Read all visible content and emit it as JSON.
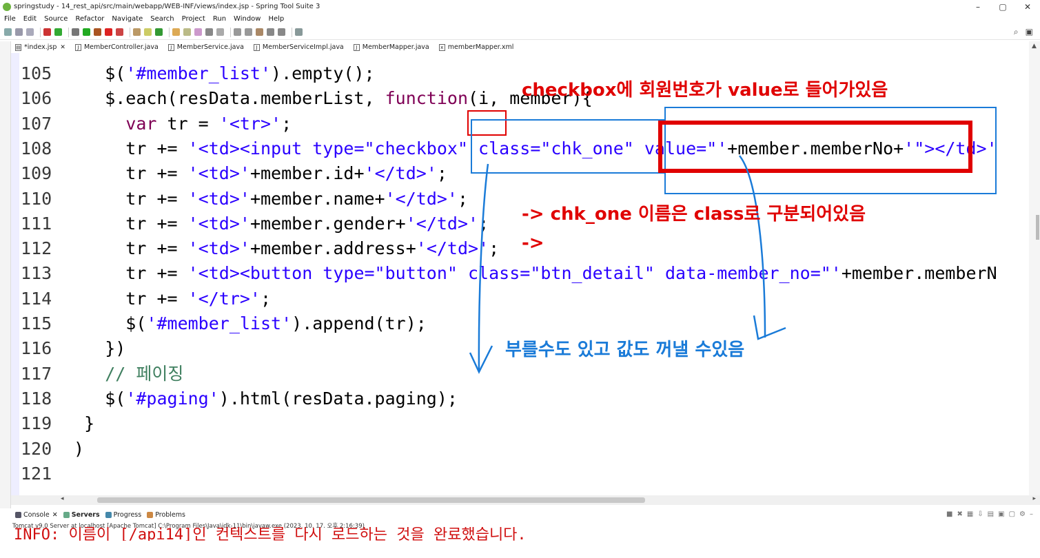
{
  "window": {
    "title": "springstudy - 14_rest_api/src/main/webapp/WEB-INF/views/index.jsp - Spring Tool Suite 3",
    "controls": [
      "–",
      "▢",
      "✕"
    ]
  },
  "menu": [
    "File",
    "Edit",
    "Source",
    "Refactor",
    "Navigate",
    "Search",
    "Project",
    "Run",
    "Window",
    "Help"
  ],
  "tabs": [
    {
      "label": "*index.jsp",
      "active": true,
      "closable": true
    },
    {
      "label": "MemberController.java"
    },
    {
      "label": "MemberService.java"
    },
    {
      "label": "MemberServiceImpl.java"
    },
    {
      "label": "MemberMapper.java"
    },
    {
      "label": "memberMapper.xml"
    }
  ],
  "code": [
    {
      "num": "105",
      "segs": [
        {
          "t": "    $(",
          "c": ""
        },
        {
          "t": "'#member_list'",
          "c": "str"
        },
        {
          "t": ").empty();",
          "c": ""
        }
      ]
    },
    {
      "num": "106",
      "segs": [
        {
          "t": "    $.each(resData.memberList, ",
          "c": ""
        },
        {
          "t": "function",
          "c": "kw"
        },
        {
          "t": "(i, member){",
          "c": ""
        }
      ]
    },
    {
      "num": "107",
      "segs": [
        {
          "t": "      ",
          "c": ""
        },
        {
          "t": "var",
          "c": "kw"
        },
        {
          "t": " tr = ",
          "c": ""
        },
        {
          "t": "'<tr>'",
          "c": "str"
        },
        {
          "t": ";",
          "c": ""
        }
      ]
    },
    {
      "num": "108",
      "segs": [
        {
          "t": "      tr += ",
          "c": ""
        },
        {
          "t": "'<td><input type=\"checkbox\" class=\"chk_one\" value=\"'",
          "c": "str"
        },
        {
          "t": "+member.memberNo+",
          "c": ""
        },
        {
          "t": "'\"></td>'",
          "c": "str"
        }
      ]
    },
    {
      "num": "109",
      "segs": [
        {
          "t": "      tr += ",
          "c": ""
        },
        {
          "t": "'<td>'",
          "c": "str"
        },
        {
          "t": "+member.id+",
          "c": ""
        },
        {
          "t": "'</td>'",
          "c": "str"
        },
        {
          "t": ";",
          "c": ""
        }
      ]
    },
    {
      "num": "110",
      "segs": [
        {
          "t": "      tr += ",
          "c": ""
        },
        {
          "t": "'<td>'",
          "c": "str"
        },
        {
          "t": "+member.name+",
          "c": ""
        },
        {
          "t": "'</td>'",
          "c": "str"
        },
        {
          "t": ";",
          "c": ""
        }
      ]
    },
    {
      "num": "111",
      "segs": [
        {
          "t": "      tr += ",
          "c": ""
        },
        {
          "t": "'<td>'",
          "c": "str"
        },
        {
          "t": "+member.gender+",
          "c": ""
        },
        {
          "t": "'</td>'",
          "c": "str"
        },
        {
          "t": ";",
          "c": ""
        }
      ]
    },
    {
      "num": "112",
      "segs": [
        {
          "t": "      tr += ",
          "c": ""
        },
        {
          "t": "'<td>'",
          "c": "str"
        },
        {
          "t": "+member.address+",
          "c": ""
        },
        {
          "t": "'</td>'",
          "c": "str"
        },
        {
          "t": ";",
          "c": ""
        }
      ]
    },
    {
      "num": "113",
      "segs": [
        {
          "t": "      tr += ",
          "c": ""
        },
        {
          "t": "'<td><button type=\"button\" class=\"btn_detail\" data-member_no=\"'",
          "c": "str"
        },
        {
          "t": "+member.memberN",
          "c": ""
        }
      ]
    },
    {
      "num": "114",
      "segs": [
        {
          "t": "      tr += ",
          "c": ""
        },
        {
          "t": "'</tr>'",
          "c": "str"
        },
        {
          "t": ";",
          "c": ""
        }
      ]
    },
    {
      "num": "115",
      "segs": [
        {
          "t": "      $(",
          "c": ""
        },
        {
          "t": "'#member_list'",
          "c": "str"
        },
        {
          "t": ").append(tr);",
          "c": ""
        }
      ]
    },
    {
      "num": "116",
      "segs": [
        {
          "t": "    })",
          "c": ""
        }
      ]
    },
    {
      "num": "117",
      "segs": [
        {
          "t": "    // 페이징",
          "c": "cmt"
        }
      ]
    },
    {
      "num": "118",
      "segs": [
        {
          "t": "    $(",
          "c": ""
        },
        {
          "t": "'#paging'",
          "c": "str"
        },
        {
          "t": ").html(resData.paging);",
          "c": ""
        }
      ]
    },
    {
      "num": "119",
      "segs": [
        {
          "t": "  }",
          "c": ""
        }
      ]
    },
    {
      "num": "120",
      "segs": [
        {
          "t": " )",
          "c": ""
        }
      ]
    },
    {
      "num": "121",
      "segs": [
        {
          "t": "",
          "c": ""
        }
      ]
    }
  ],
  "annotations": {
    "top": "checkbox에 회원번호가 value로 들어가있음",
    "middle": "-> chk_one 이름은 class로 구분되어있음",
    "arrow_only": "->",
    "bottom": "부를수도 있고    값도 꺼낼 수있음"
  },
  "bottom_panel": {
    "tabs": [
      {
        "label": "Console",
        "closable": true
      },
      {
        "label": "Servers",
        "active": true
      },
      {
        "label": "Progress"
      },
      {
        "label": "Problems"
      }
    ],
    "path": "Tomcat v9.0 Server at localhost [Apache Tomcat] C:\\Program Files\\Java\\jdk-11\\bin\\javaw.exe  (2023. 10. 17. 오후 2:16:39)",
    "console_line": "INFO: 이름이 [/api14]인 컨텍스트를 다시 로드하는 것을 완료했습니다."
  },
  "colors": {
    "keyword": "#7f0055",
    "string": "#2a00ff",
    "comment": "#3f7f5f",
    "annotation_red": "#e00000",
    "annotation_blue": "#1a7bd8"
  }
}
